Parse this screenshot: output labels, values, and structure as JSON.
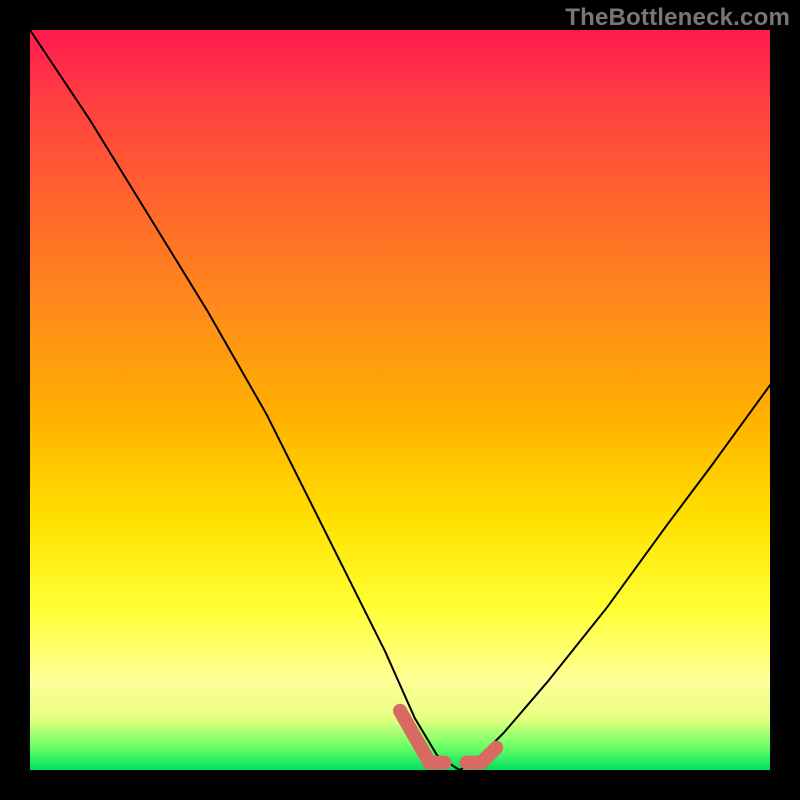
{
  "attribution": "TheBottleneck.com",
  "chart_data": {
    "type": "line",
    "title": "",
    "xlabel": "",
    "ylabel": "",
    "xlim": [
      0,
      100
    ],
    "ylim": [
      0,
      100
    ],
    "background_gradient": {
      "top_color": "#ff1a4f",
      "bottom_color": "#00e060",
      "meaning": "red = large bottleneck, green = balanced"
    },
    "series": [
      {
        "name": "bottleneck-curve",
        "color": "#000000",
        "x": [
          0,
          8,
          16,
          24,
          32,
          40,
          48,
          52,
          55,
          58,
          60,
          64,
          70,
          78,
          86,
          92,
          100
        ],
        "values": [
          100,
          88,
          75,
          62,
          48,
          32,
          16,
          7,
          2,
          0,
          1,
          5,
          12,
          22,
          33,
          41,
          52
        ]
      },
      {
        "name": "optimal-marker-left",
        "color": "#d96a62",
        "style": "thick-rounded",
        "x": [
          50,
          54,
          56
        ],
        "values": [
          8,
          1,
          1
        ]
      },
      {
        "name": "optimal-marker-right",
        "color": "#d96a62",
        "style": "thick-rounded",
        "x": [
          59,
          61,
          63
        ],
        "values": [
          1,
          1,
          3
        ]
      }
    ],
    "optimal_x": 58
  }
}
